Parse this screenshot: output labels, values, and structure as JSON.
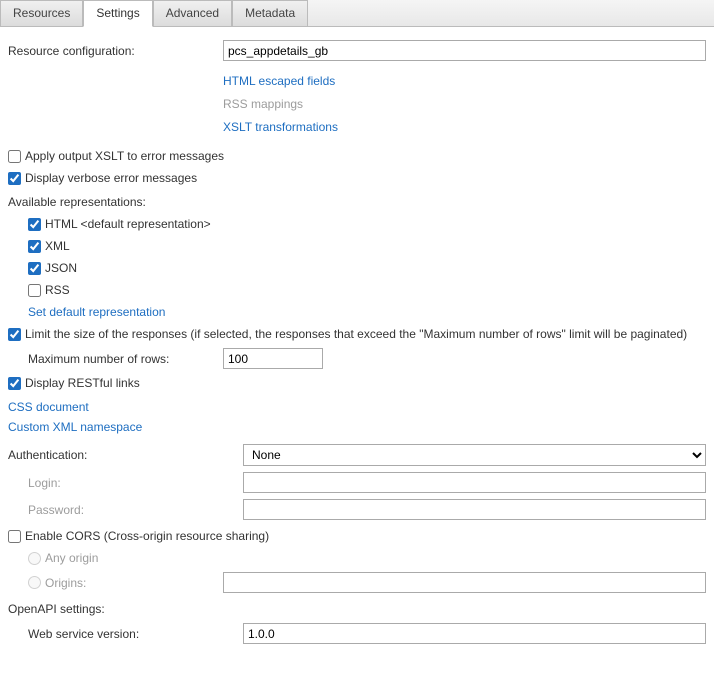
{
  "tabs": {
    "resources": "Resources",
    "settings": "Settings",
    "advanced": "Advanced",
    "metadata": "Metadata"
  },
  "resource_config": {
    "label": "Resource configuration:",
    "value": "pcs_appdetails_gb",
    "links": {
      "html_escaped": "HTML escaped fields",
      "rss_mappings": "RSS mappings",
      "xslt": "XSLT transformations"
    }
  },
  "apply_xslt": {
    "label": "Apply output XSLT to error messages",
    "checked": false
  },
  "display_verbose": {
    "label": "Display verbose error messages",
    "checked": true
  },
  "available_reps": {
    "label": "Available representations:",
    "html": {
      "label": "HTML <default representation>",
      "checked": true
    },
    "xml": {
      "label": "XML",
      "checked": true
    },
    "json": {
      "label": "JSON",
      "checked": true
    },
    "rss": {
      "label": "RSS",
      "checked": false
    },
    "set_default": "Set default representation"
  },
  "limit_size": {
    "label": "Limit the size of the responses (if selected, the responses that exceed the \"Maximum number of rows\" limit will be paginated)",
    "checked": true
  },
  "max_rows": {
    "label": "Maximum number of rows:",
    "value": "100"
  },
  "restful": {
    "label": "Display RESTful links",
    "checked": true
  },
  "css_doc": "CSS document",
  "custom_xml": "Custom XML namespace",
  "auth": {
    "label": "Authentication:",
    "value": "None",
    "login_label": "Login:",
    "login_value": "",
    "password_label": "Password:",
    "password_value": ""
  },
  "cors": {
    "label": "Enable CORS (Cross-origin resource sharing)",
    "checked": false,
    "any_origin": "Any origin",
    "origins": "Origins:",
    "origins_value": ""
  },
  "openapi": {
    "label": "OpenAPI settings:",
    "version_label": "Web service version:",
    "version_value": "1.0.0"
  }
}
